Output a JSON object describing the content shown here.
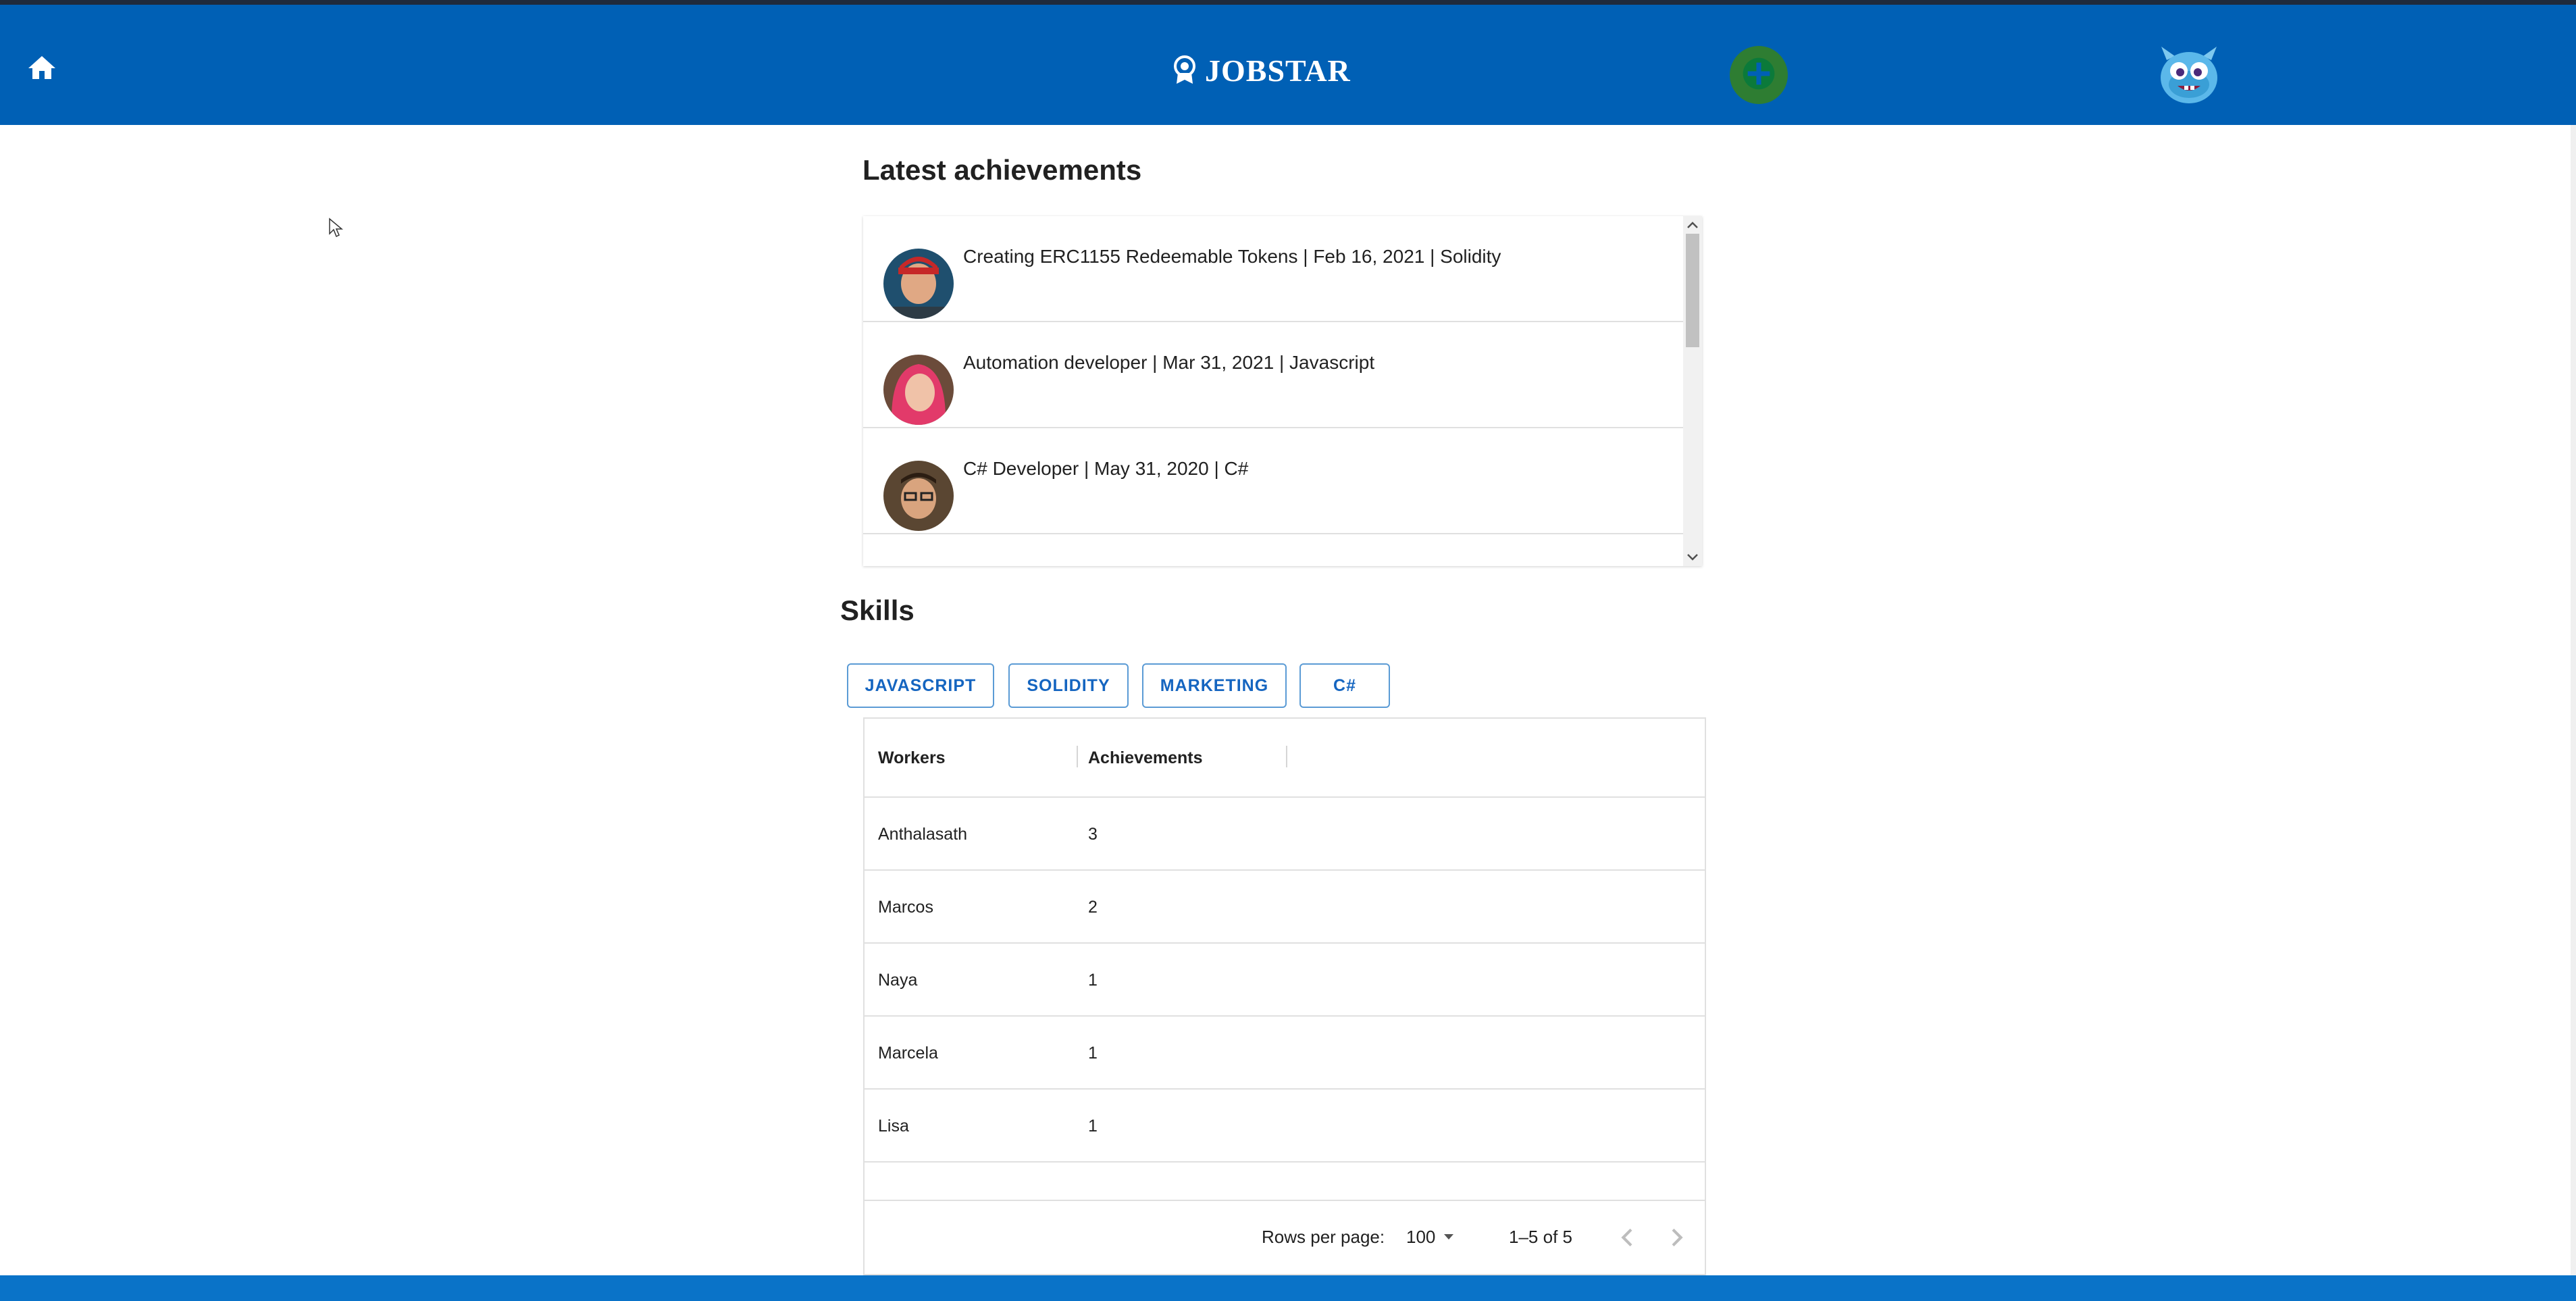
{
  "header": {
    "brand": "JOBSTAR",
    "icons": {
      "home": "home-icon",
      "brand": "award-icon",
      "add": "plus-icon",
      "profile": "monster-avatar-icon"
    },
    "colors": {
      "bar": "#0060b5",
      "add_button": "#2e7d32"
    }
  },
  "achievements": {
    "title": "Latest achievements",
    "items": [
      {
        "text": "Creating ERC1155 Redeemable Tokens | Feb 16, 2021 | Solidity"
      },
      {
        "text": "Automation developer | Mar 31, 2021 | Javascript"
      },
      {
        "text": "C# Developer | May 31, 2020 | C#"
      }
    ]
  },
  "skills": {
    "title": "Skills",
    "buttons": [
      "JAVASCRIPT",
      "SOLIDITY",
      "MARKETING",
      "C#"
    ],
    "table": {
      "columns": [
        "Workers",
        "Achievements"
      ],
      "rows": [
        {
          "worker": "Anthalasath",
          "achievements": "3"
        },
        {
          "worker": "Marcos",
          "achievements": "2"
        },
        {
          "worker": "Naya",
          "achievements": "1"
        },
        {
          "worker": "Marcela",
          "achievements": "1"
        },
        {
          "worker": "Lisa",
          "achievements": "1"
        }
      ],
      "footer": {
        "rows_per_page_label": "Rows per page:",
        "rows_per_page_value": "100",
        "range": "1–5 of 5"
      }
    }
  }
}
